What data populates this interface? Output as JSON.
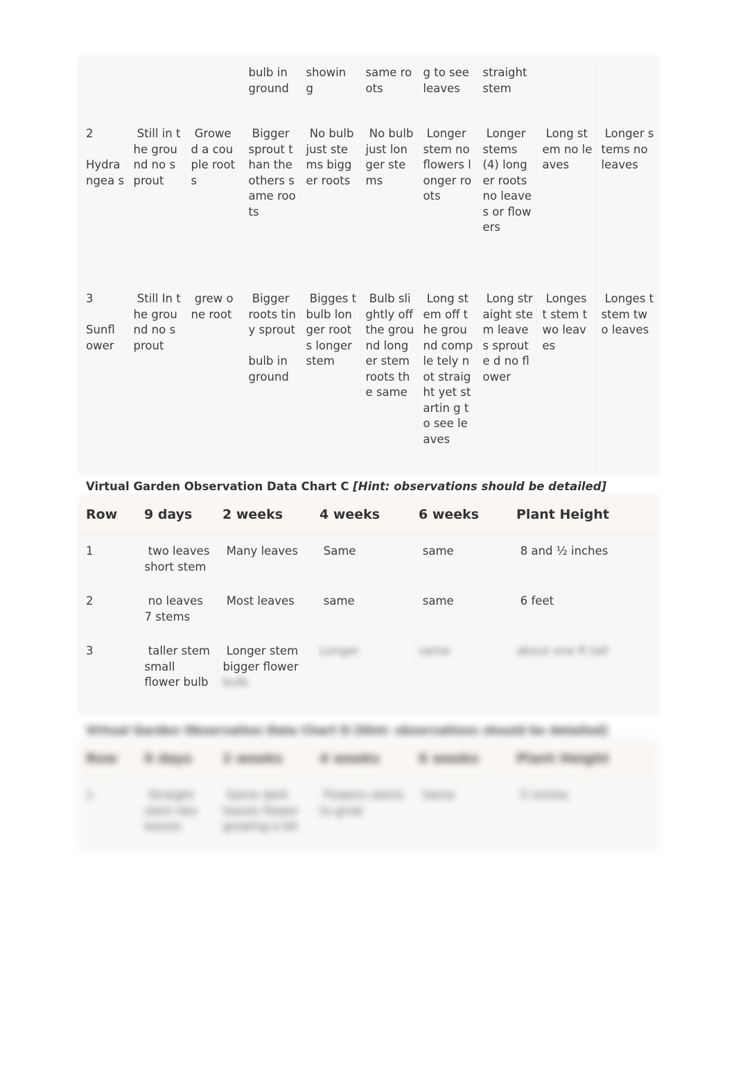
{
  "chart_b_continued": {
    "rows": [
      {
        "row": "",
        "cells": [
          "",
          "",
          "bulb in ground",
          "showin g",
          "same roots",
          "g to see leaves",
          "straight stem",
          "",
          ""
        ]
      },
      {
        "row": "2\n\nHydra ngea s",
        "cells": [
          " Still in the ground no sprout",
          " Growe d a couple roots",
          " Bigger sprout than the others same roots",
          " No bulb just stems bigger roots",
          " No bulb just longer stems",
          " Longer stem no flowers longer roots",
          " Longer stems (4) longer roots no leaves or flowers",
          " Long stem no leaves",
          " Longer stems no leaves"
        ]
      },
      {
        "row": "3\n\nSunfl ower",
        "cells": [
          " Still In the ground no sprout",
          " grew one root",
          " Bigger roots tiny sprout\n\nbulb in ground",
          " Bigges t bulb longer roots longer stem",
          " Bulb slightly off the ground longer stem roots the same",
          " Long stem off the ground comple tely not straight yet startin g to see leaves",
          " Long straight stem leaves sproute d no flower",
          " Longes t stem two leaves",
          " Longes t stem two leaves"
        ]
      }
    ]
  },
  "chart_c": {
    "title": "Virtual Garden Observation Data Chart C ",
    "hint": "[Hint: observations should be detailed]",
    "headers": [
      "Row",
      "9 days",
      "2 weeks",
      "4 weeks",
      "6 weeks",
      "Plant Height"
    ],
    "rows": [
      {
        "cells": [
          "1",
          " two leaves short stem",
          " Many leaves",
          " Same",
          " same",
          " 8 and ½ inches"
        ]
      },
      {
        "cells": [
          "2",
          " no leaves 7 stems",
          " Most leaves",
          " same",
          " same",
          " 6 feet"
        ]
      },
      {
        "cells": [
          "3",
          " taller stem small flower bulb",
          " Longer stem bigger flower",
          "",
          "",
          ""
        ]
      }
    ],
    "blurred_placeholders": [
      "bulb",
      "Longer",
      "same",
      "about one ft tall"
    ]
  },
  "chart_d_blurred": {
    "title": "Virtual Garden Observation Data Chart D [Hint: observations should be detailed]",
    "headers": [
      "Row",
      "9 days",
      "2 weeks",
      "4 weeks",
      "6 weeks",
      "Plant Height"
    ],
    "rows": [
      {
        "cells": [
          "1",
          " Straight stem two leaves",
          " Same dark leaves flower growing a bit",
          " Flowers starts to grow",
          " Same",
          " 5 inches"
        ]
      }
    ]
  }
}
